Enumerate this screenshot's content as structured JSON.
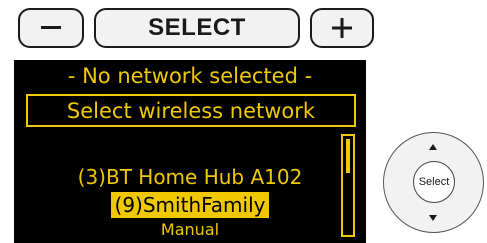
{
  "controls": {
    "minus_icon": "minus-icon",
    "select_label": "SELECT",
    "plus_icon": "plus-icon"
  },
  "display": {
    "status": "- No network selected -",
    "menu_title": "Select wireless network",
    "networks": [
      "(3)BT Home Hub A102",
      "(9)SmithFamily",
      "Manual"
    ],
    "highlighted_index": 1
  },
  "dial": {
    "center_label": "Select",
    "up_icon": "up-arrow-icon",
    "down_icon": "down-arrow-icon"
  },
  "colors": {
    "screen_background": "#000000",
    "screen_text": "#f0c800",
    "highlight_background": "#f0c800",
    "highlight_text": "#000000"
  }
}
